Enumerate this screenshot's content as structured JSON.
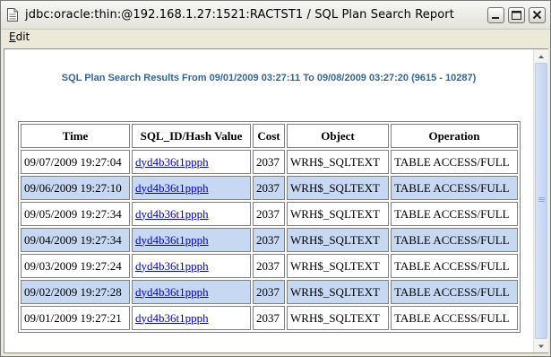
{
  "window": {
    "title": "jdbc:oracle:thin:@192.168.1.27:1521:RACTST1 / SQL Plan Search Report",
    "controls": [
      "minimize-icon",
      "maximize-icon",
      "close-icon"
    ]
  },
  "menubar": {
    "items": [
      {
        "label": "Edit"
      }
    ]
  },
  "report": {
    "title": "SQL Plan Search Results From 09/01/2009 03:27:11 To 09/08/2009 03:27:20 (9615 - 10287)",
    "alt_row_color": "#c6d8f2",
    "title_color": "#336699",
    "link_color": "#0000cc",
    "columns": [
      "Time",
      "SQL_ID/Hash Value",
      "Cost",
      "Object",
      "Operation"
    ],
    "rows": [
      {
        "time": "09/07/2009 19:27:04",
        "sql_id": "dyd4b36t1ppph",
        "cost": "2037",
        "object": "WRH$_SQLTEXT",
        "operation": "TABLE ACCESS/FULL"
      },
      {
        "time": "09/06/2009 19:27:10",
        "sql_id": "dyd4b36t1ppph",
        "cost": "2037",
        "object": "WRH$_SQLTEXT",
        "operation": "TABLE ACCESS/FULL"
      },
      {
        "time": "09/05/2009 19:27:34",
        "sql_id": "dyd4b36t1ppph",
        "cost": "2037",
        "object": "WRH$_SQLTEXT",
        "operation": "TABLE ACCESS/FULL"
      },
      {
        "time": "09/04/2009 19:27:34",
        "sql_id": "dyd4b36t1ppph",
        "cost": "2037",
        "object": "WRH$_SQLTEXT",
        "operation": "TABLE ACCESS/FULL"
      },
      {
        "time": "09/03/2009 19:27:24",
        "sql_id": "dyd4b36t1ppph",
        "cost": "2037",
        "object": "WRH$_SQLTEXT",
        "operation": "TABLE ACCESS/FULL"
      },
      {
        "time": "09/02/2009 19:27:28",
        "sql_id": "dyd4b36t1ppph",
        "cost": "2037",
        "object": "WRH$_SQLTEXT",
        "operation": "TABLE ACCESS/FULL"
      },
      {
        "time": "09/01/2009 19:27:21",
        "sql_id": "dyd4b36t1ppph",
        "cost": "2037",
        "object": "WRH$_SQLTEXT",
        "operation": "TABLE ACCESS/FULL"
      }
    ]
  }
}
